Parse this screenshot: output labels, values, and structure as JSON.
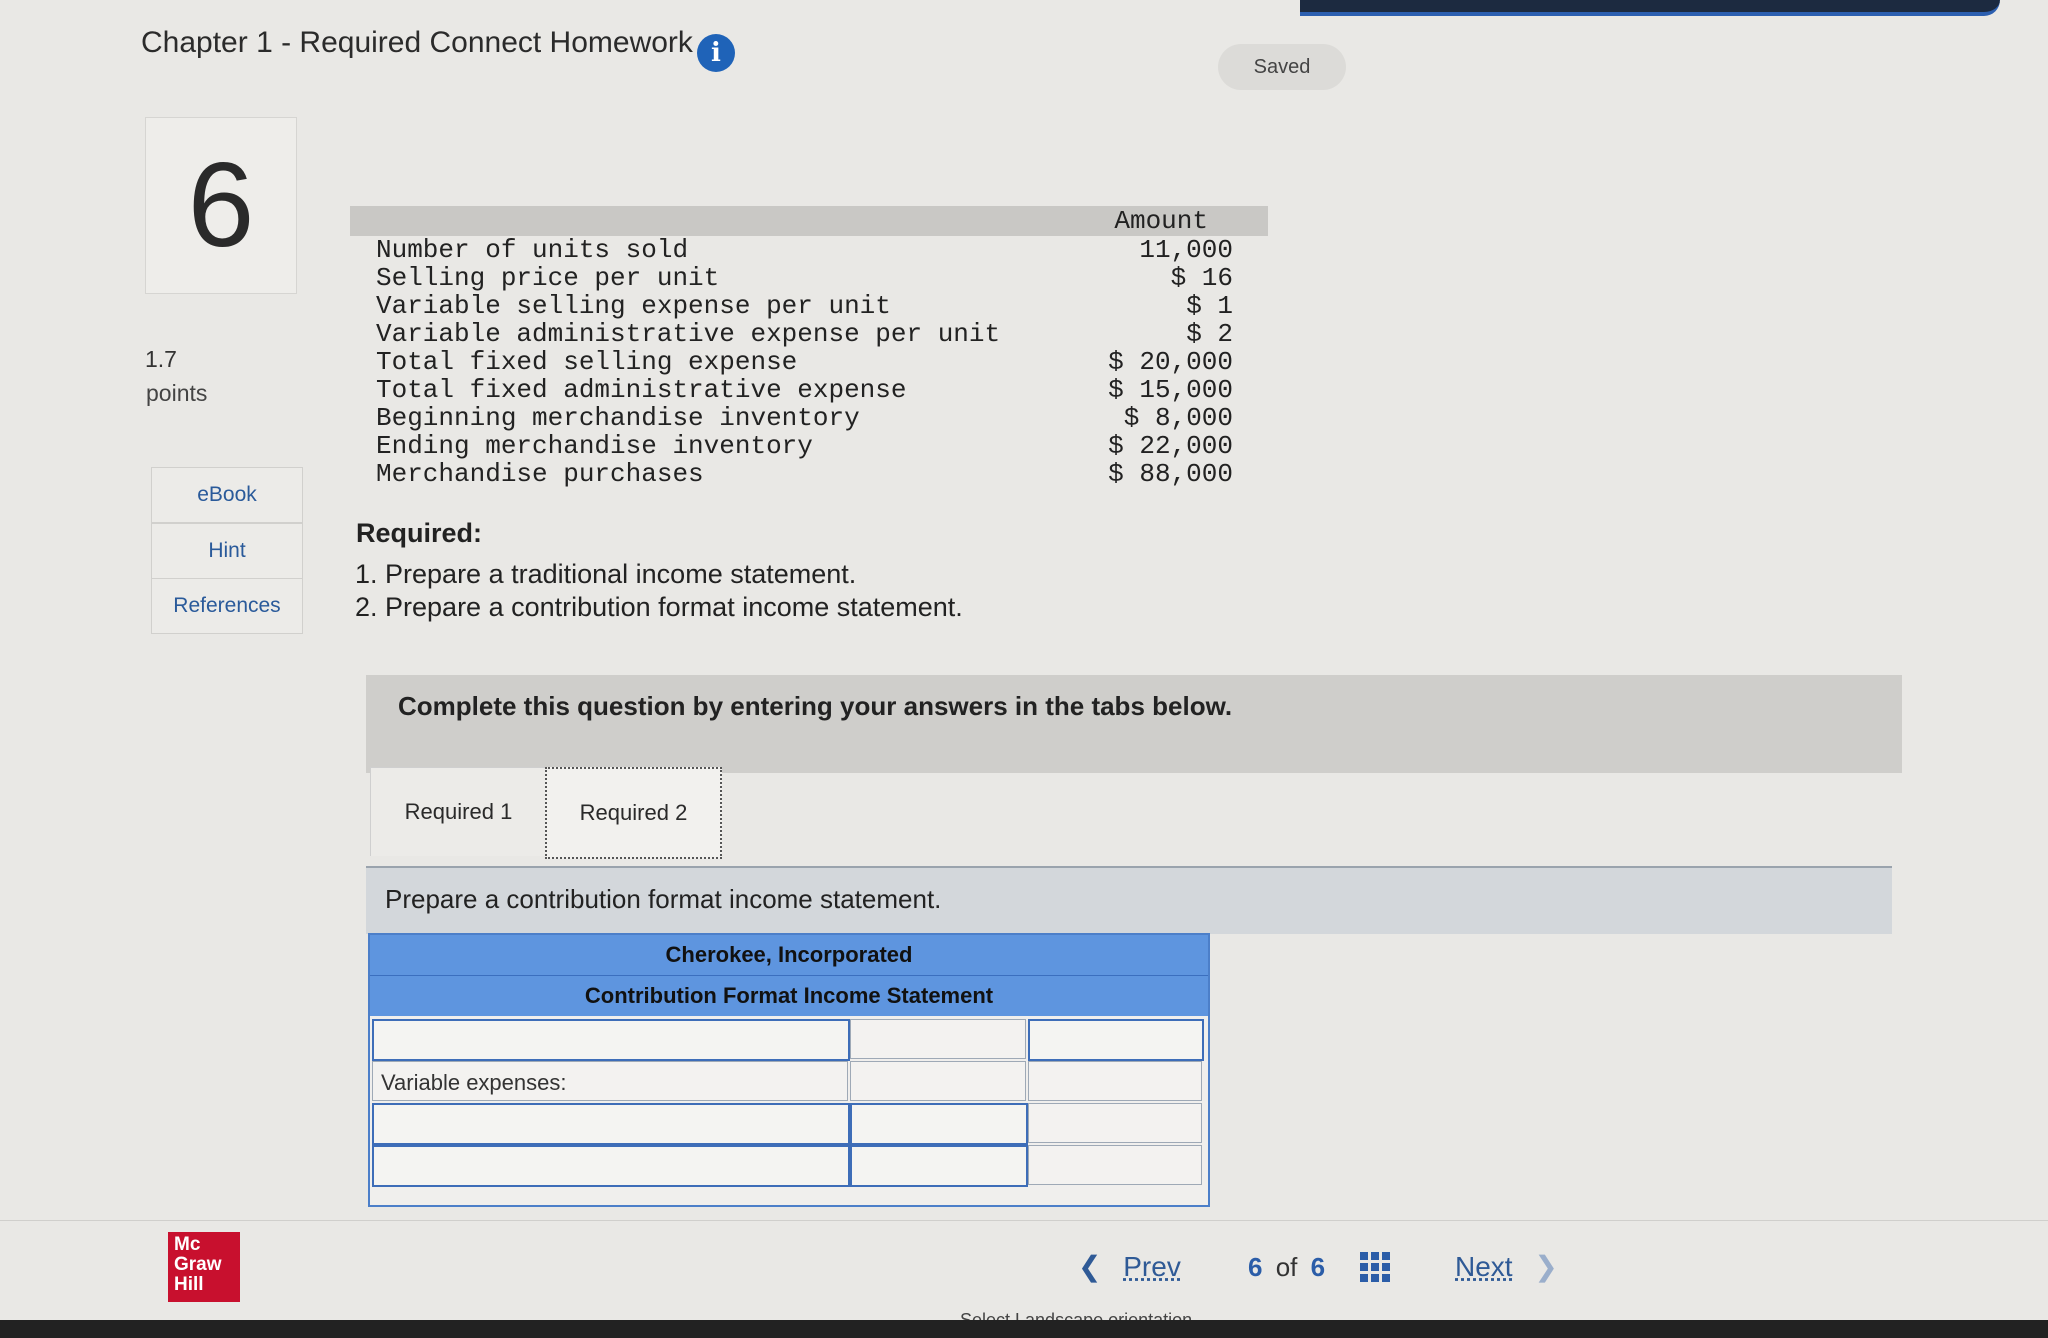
{
  "header": {
    "title": "Chapter 1 - Required Connect Homework",
    "info_icon": "i",
    "saved_label": "Saved"
  },
  "question": {
    "number": "6",
    "points_value": "1.7",
    "points_label": "points"
  },
  "sidebar": {
    "buttons": [
      {
        "label": "eBook"
      },
      {
        "label": "Hint"
      },
      {
        "label": "References"
      }
    ]
  },
  "data_table": {
    "header": "Amount",
    "rows": [
      {
        "label": "Number of units sold",
        "amount": "11,000"
      },
      {
        "label": "Selling price per unit",
        "amount": "$ 16"
      },
      {
        "label": "Variable selling expense per unit",
        "amount": "$ 1"
      },
      {
        "label": "Variable administrative expense per unit",
        "amount": "$ 2"
      },
      {
        "label": "Total fixed selling expense",
        "amount": "$ 20,000"
      },
      {
        "label": "Total fixed administrative expense",
        "amount": "$ 15,000"
      },
      {
        "label": "Beginning merchandise inventory",
        "amount": "$ 8,000"
      },
      {
        "label": "Ending merchandise inventory",
        "amount": "$ 22,000"
      },
      {
        "label": "Merchandise purchases",
        "amount": "$ 88,000"
      }
    ]
  },
  "required": {
    "heading": "Required:",
    "items": [
      "1. Prepare a traditional income statement.",
      "2. Prepare a contribution format income statement."
    ]
  },
  "instructions": "Complete this question by entering your answers in the tabs below.",
  "tabs": [
    {
      "label": "Required 1"
    },
    {
      "label": "Required 2"
    }
  ],
  "active_tab_prompt": "Prepare a contribution format income statement.",
  "statement": {
    "company": "Cherokee, Incorporated",
    "title": "Contribution Format Income Statement",
    "variable_expenses_label": "Variable expenses:"
  },
  "footer": {
    "logo_lines": [
      "Mc",
      "Graw",
      "Hill"
    ],
    "prev_label": "Prev",
    "page_current": "6",
    "page_of": "of",
    "page_total": "6",
    "next_label": "Next",
    "caption": "Select Landscape orientation."
  }
}
